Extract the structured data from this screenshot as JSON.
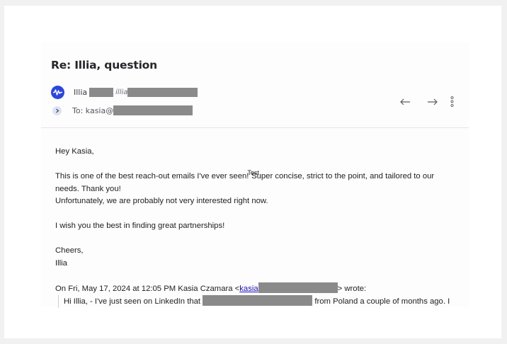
{
  "subject": "Re: Illia, question",
  "sender": {
    "name": "Illia",
    "email_prefix": "illia"
  },
  "recipient": {
    "label": "To: kasia@"
  },
  "icons": {
    "avatar": "waveform-icon",
    "expand": "chevron-right-icon",
    "reply": "reply-arrow-icon",
    "forward": "forward-arrow-icon",
    "more": "more-vertical-icon"
  },
  "body": {
    "greeting": "Hey Kasia,",
    "p1a": "This is one of the best reach-out emails I've ever seen!",
    "overlay": "Test",
    "p1b": " Super concise, strict to the point, and tailored to our",
    "p1c": "needs. Thank you!",
    "p2": "Unfortunately, we are probably not very interested right now.",
    "p3": "I wish you the best in finding great partnerships!",
    "closing": "Cheers,",
    "signature": "Illia"
  },
  "quote": {
    "header_prefix": "On Fri, May 17, 2024 at 12:05 PM Kasia Czamara <",
    "link_text": "kasia",
    "header_suffix": "> wrote:",
    "line_prefix": "Hi Illia, - I've just seen on LinkedIn that",
    "line_suffix": "from Poland a couple of months ago. I"
  },
  "colors": {
    "accent": "#2c47d8",
    "link": "#1a0dab",
    "redaction": "#8a8a8a"
  }
}
